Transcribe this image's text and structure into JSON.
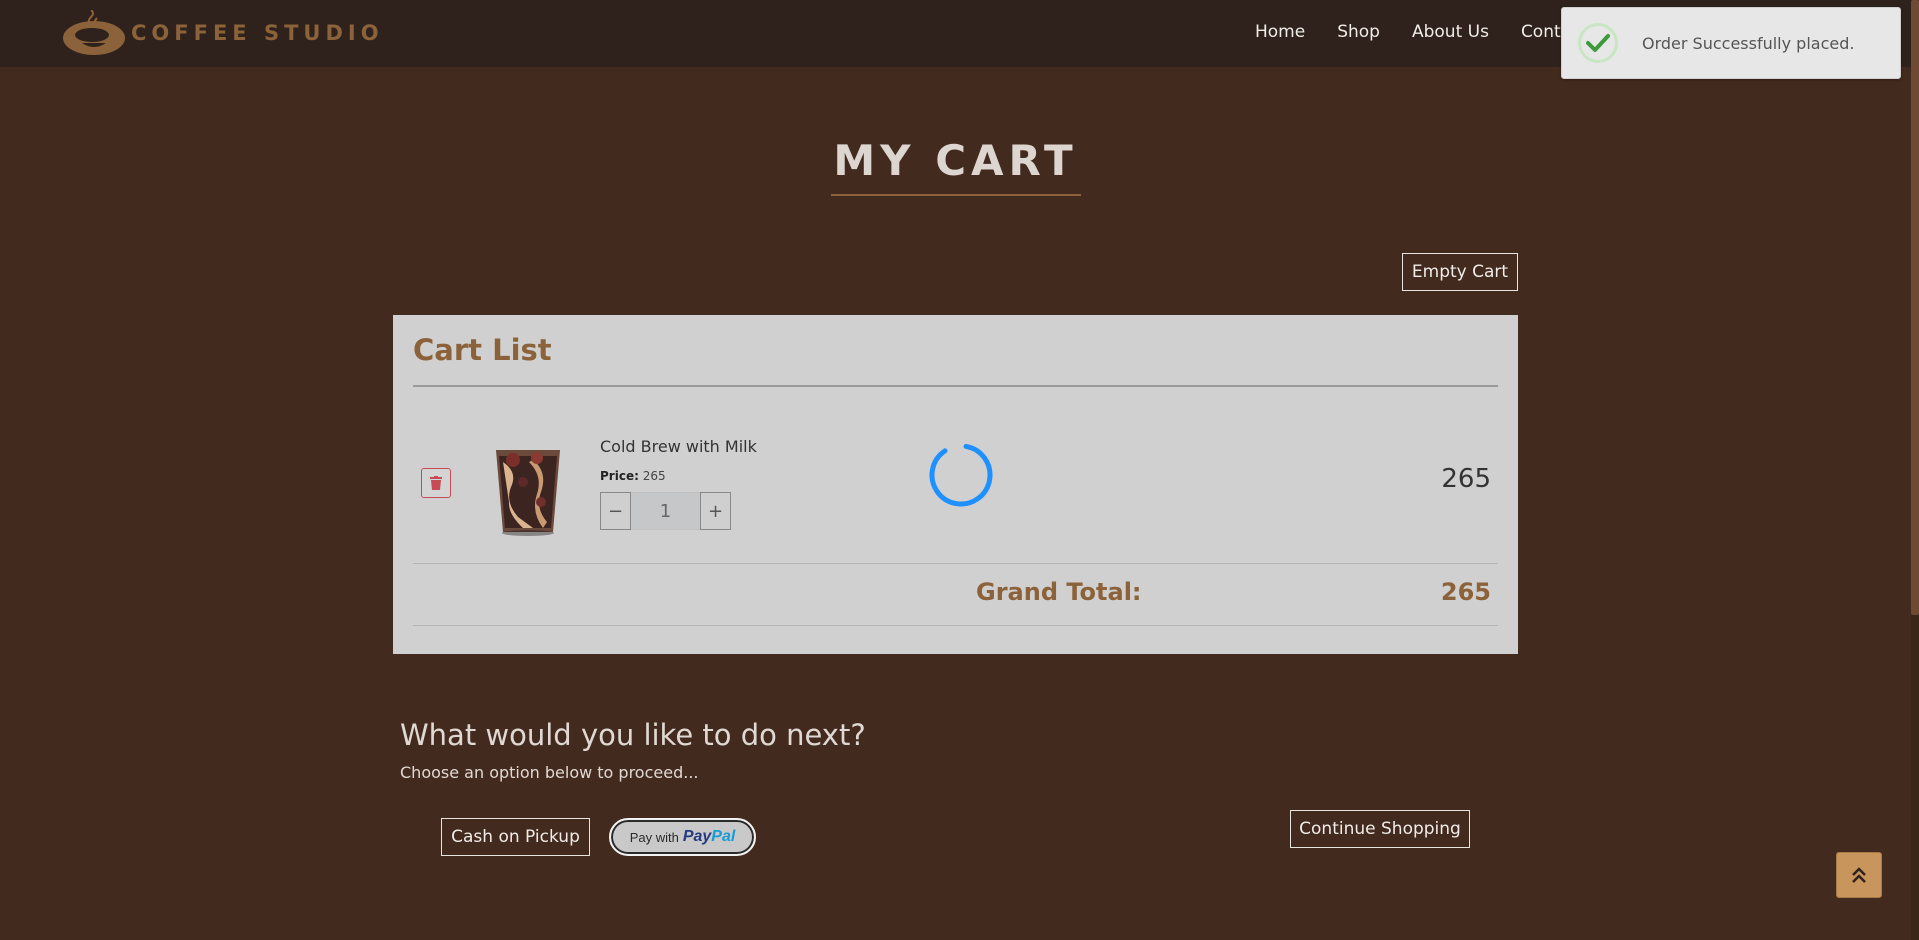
{
  "navbar": {
    "brand": "COFFEE STUDIO",
    "links": [
      "Home",
      "Shop",
      "About Us",
      "Cont"
    ]
  },
  "toast": {
    "message": "Order Successfully placed."
  },
  "page": {
    "title": "MY CART",
    "empty_cart_label": "Empty Cart"
  },
  "cart": {
    "heading": "Cart List",
    "item": {
      "name": "Cold Brew with Milk",
      "price_label": "Price:",
      "price": "265",
      "quantity": "1",
      "minus": "−",
      "plus": "+",
      "total": "265"
    },
    "grand_total_label": "Grand Total:",
    "grand_total": "265"
  },
  "next": {
    "heading": "What would you like to do next?",
    "subtext": "Choose an option below to proceed...",
    "cash_label": "Cash on Pickup",
    "paypal_prefix": "Pay with",
    "paypal_pay": "Pay",
    "paypal_pal": "Pal",
    "continue_label": "Continue Shopping"
  },
  "colors": {
    "background": "#432a1e",
    "navbar": "#2f221c",
    "accent": "#8b6239",
    "card": "#d0d0d0",
    "spinner": "#1e90ff",
    "success": "#3c9a3c"
  },
  "icons": {
    "brand": "coffee-cup-logo-icon",
    "toast": "checkmark-icon",
    "delete": "trash-icon",
    "loading": "spinner-icon",
    "scroll_top": "double-chevron-up-icon"
  }
}
